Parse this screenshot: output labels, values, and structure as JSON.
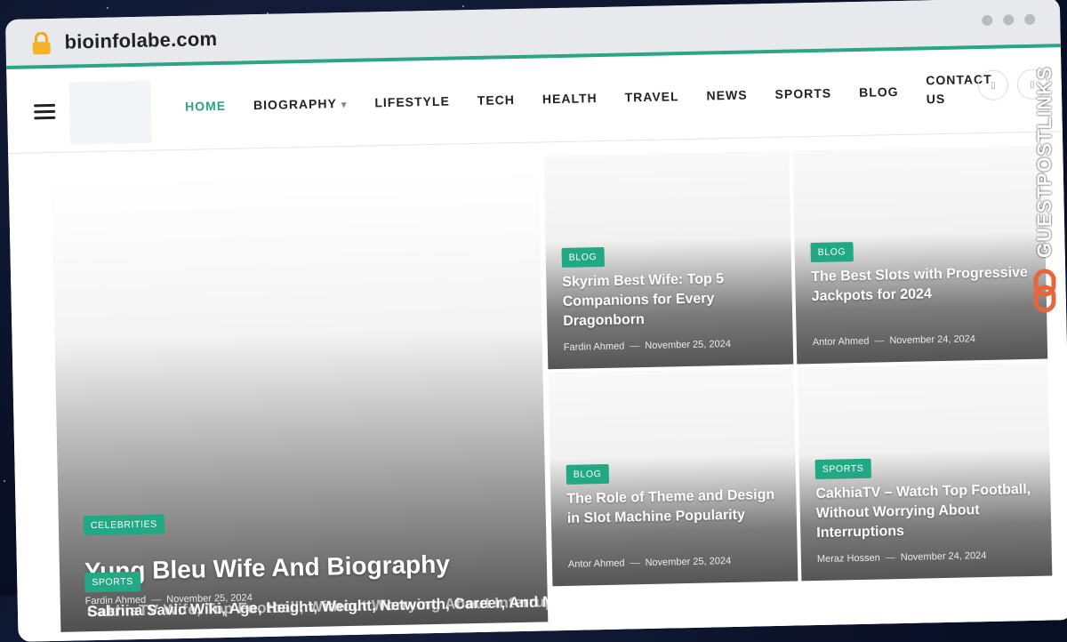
{
  "browser": {
    "url": "bioinfolabe.com",
    "watermark": "GUESTPOSTLINKS"
  },
  "colors": {
    "accent": "#2aa585",
    "badge": "#23a884",
    "brand_orange": "#e8643c"
  },
  "nav": {
    "items": [
      {
        "label": "HOME",
        "active": true
      },
      {
        "label": "BIOGRAPHY",
        "has_dropdown": true
      },
      {
        "label": "LIFESTYLE"
      },
      {
        "label": "TECH"
      },
      {
        "label": "HEALTH"
      },
      {
        "label": "TRAVEL"
      },
      {
        "label": "NEWS"
      },
      {
        "label": "SPORTS"
      },
      {
        "label": "BLOG"
      },
      {
        "label": "CONTACT US"
      }
    ],
    "icons": [
      "menu-icon",
      "chevron-down-icon",
      "search-icon",
      "theme-toggle-icon"
    ]
  },
  "featured": {
    "category": "CELEBRITIES",
    "title": "Yung Bleu Wife And Biography",
    "author": "Fardin Ahmed",
    "date": "November 25, 2024",
    "overlap_category": "SPORTS",
    "overlap_title_a": "Sabrina Savic Wiki, Age, Height, Weight, Networth, Career, And More",
    "overlap_title_b": "CakhiaTV Wife, Top Football, Without Worrying About Interruptions"
  },
  "posts": [
    {
      "category": "BLOG",
      "title": "Skyrim Best Wife: Top 5 Companions for Every Dragonborn",
      "author": "Fardin Ahmed",
      "date": "November 25, 2024"
    },
    {
      "category": "BLOG",
      "title": "The Best Slots with Progressive Jackpots for 2024",
      "author": "Antor Ahmed",
      "date": "November 24, 2024"
    },
    {
      "category": "BLOG",
      "title": "The Role of Theme and Design in Slot Machine Popularity",
      "author": "Antor Ahmed",
      "date": "November 25, 2024"
    },
    {
      "category": "SPORTS",
      "title": "CakhiaTV – Watch Top Football, Without Worrying About Interruptions",
      "author": "Meraz Hossen",
      "date": "November 24, 2024"
    }
  ]
}
